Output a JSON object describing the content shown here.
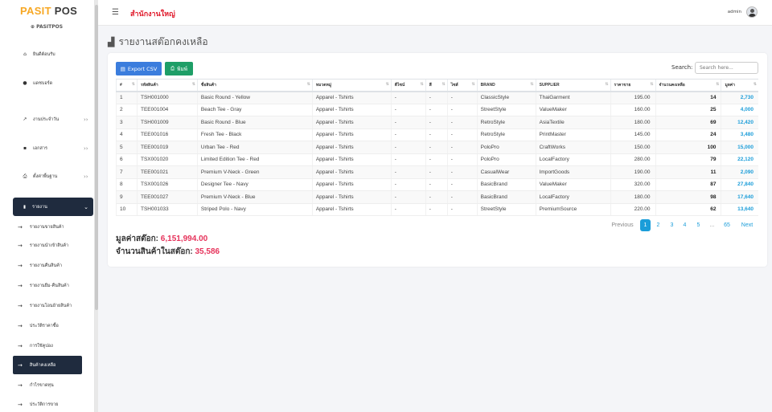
{
  "brand": {
    "part1": "PASIT",
    "part2": " POS",
    "sub": "PASITPOS"
  },
  "menu": {
    "welcome": "ยินดีต้อนรับ",
    "dashboard": "แดชบอร์ด",
    "daily": "งานประจำวัน",
    "docs": "เอกสาร",
    "settings": "ตั้งค่าพื้นฐาน",
    "report": "รายงาน",
    "subs": [
      "รายงานขายสินค้า",
      "รายงานนำเข้าสินค้า",
      "รายงานคืนสินค้า",
      "รายงานยืม-คืนสินค้า",
      "รายงานโอนย้ายสินค้า",
      "ประวัติราคาซื้อ",
      "การใช้คูปอง",
      "สินค้าคงเหลือ",
      "กำไรขาดทุน",
      "ประวัติการขาย"
    ]
  },
  "topbar": {
    "branch": "สำนักงานใหญ่",
    "user": "admin"
  },
  "page": {
    "title": "รายงานสต๊อกคงเหลือ"
  },
  "toolbar": {
    "csv": "Export CSV",
    "print": "พิมพ์",
    "search_label": "Search:",
    "search_placeholder": "Search here..."
  },
  "table": {
    "headers": [
      "#",
      "รหัสสินค้า",
      "ชื่อสินค้า",
      "หมวดหมู่",
      "ดีไซน์",
      "สี",
      "ไซส์",
      "BRAND",
      "SUPPLIER",
      "ราคาขาย",
      "จำนวนคงเหลือ",
      "มูลค่า"
    ],
    "rows": [
      [
        "1",
        "TSH001000",
        "Basic Round - Yellow",
        "Apparel - Tshirts",
        "-",
        "-",
        "-",
        "ClassicStyle",
        "ThaiGarment",
        "195.00",
        "14",
        "2,730"
      ],
      [
        "2",
        "TEE001004",
        "Beach Tee - Gray",
        "Apparel - Tshirts",
        "-",
        "-",
        "-",
        "StreetStyle",
        "ValueMaker",
        "160.00",
        "25",
        "4,000"
      ],
      [
        "3",
        "TSH001009",
        "Basic Round - Blue",
        "Apparel - Tshirts",
        "-",
        "-",
        "-",
        "RetroStyle",
        "AsiaTextile",
        "180.00",
        "69",
        "12,420"
      ],
      [
        "4",
        "TEE001016",
        "Fresh Tee - Black",
        "Apparel - Tshirts",
        "-",
        "-",
        "-",
        "RetroStyle",
        "PrintMaster",
        "145.00",
        "24",
        "3,480"
      ],
      [
        "5",
        "TEE001019",
        "Urban Tee - Red",
        "Apparel - Tshirts",
        "-",
        "-",
        "-",
        "PoloPro",
        "CraftWorks",
        "150.00",
        "100",
        "15,000"
      ],
      [
        "6",
        "TSX001020",
        "Limited Edition Tee - Red",
        "Apparel - Tshirts",
        "-",
        "-",
        "-",
        "PoloPro",
        "LocalFactory",
        "280.00",
        "79",
        "22,120"
      ],
      [
        "7",
        "TEE001021",
        "Premium V-Neck - Green",
        "Apparel - Tshirts",
        "-",
        "-",
        "-",
        "CasualWear",
        "ImportGoods",
        "190.00",
        "11",
        "2,090"
      ],
      [
        "8",
        "TSX001026",
        "Designer Tee - Navy",
        "Apparel - Tshirts",
        "-",
        "-",
        "-",
        "BasicBrand",
        "ValueMaker",
        "320.00",
        "87",
        "27,840"
      ],
      [
        "9",
        "TEE001027",
        "Premium V-Neck - Blue",
        "Apparel - Tshirts",
        "-",
        "-",
        "-",
        "BasicBrand",
        "LocalFactory",
        "180.00",
        "98",
        "17,640"
      ],
      [
        "10",
        "TSH001033",
        "Striped Polo - Navy",
        "Apparel - Tshirts",
        "-",
        "-",
        "-",
        "StreetStyle",
        "PremiumSource",
        "220.00",
        "62",
        "13,640"
      ]
    ]
  },
  "pagination": {
    "prev": "Previous",
    "pages": [
      "1",
      "2",
      "3",
      "4",
      "5",
      "...",
      "65"
    ],
    "next": "Next"
  },
  "summary": {
    "value_label": "มูลค่าสต๊อก: ",
    "value": "6,151,994.00",
    "qty_label": "จำนวนสินค้าในสต๊อก: ",
    "qty": "35,586"
  }
}
